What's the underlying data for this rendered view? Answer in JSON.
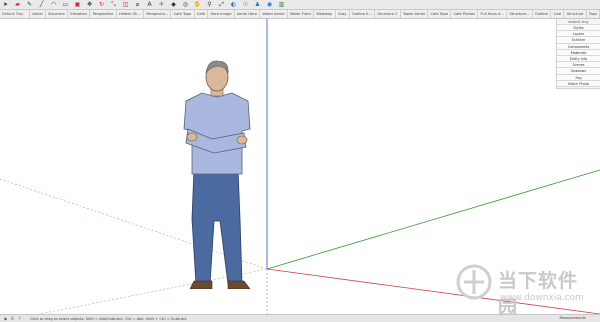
{
  "toolbar": {
    "icons": [
      "select-arrow-icon",
      "eraser-icon",
      "pencil-icon",
      "line-icon",
      "arc-icon",
      "shape-icon",
      "push-pull-icon",
      "move-icon",
      "rotate-icon",
      "scale-icon",
      "offset-icon",
      "tape-measure-icon",
      "text-icon",
      "axes-icon",
      "paint-bucket-icon",
      "orbit-icon",
      "pan-icon",
      "zoom-icon",
      "zoom-extents-icon",
      "previous-view-icon",
      "position-camera-icon",
      "walk-icon",
      "look-around-icon",
      "section-plane-icon"
    ]
  },
  "tabs": {
    "left_label": "Default Tray",
    "items": [
      "Aerial",
      "Structure",
      "Elevation",
      "Perspective",
      "Hidden Sh...",
      "Perspectiv...",
      "Cafe Topo",
      "Café",
      "Hero Image",
      "Aerial Hero",
      "Water Aerial",
      "Water Front",
      "Walkway",
      "Gray",
      "Outline E...",
      "Structure 2",
      "Tower Aerial",
      "Cafe Topo",
      "Cafe Photos",
      "Full Hous A...",
      "Structure...",
      "Outline",
      "Line",
      "Structure",
      "Tops"
    ]
  },
  "tray": {
    "title": "default tray",
    "items": [
      "Styles",
      "Layers",
      "Outliner",
      "Components",
      "Materials",
      "Entity Info",
      "Scenes",
      "Shadows",
      "Fog",
      "Match Photo"
    ]
  },
  "status": {
    "hint": "Click or drag to select objects. Shift = Add/Subtract. Ctrl = Add. Shift + Ctrl = Subtract.",
    "measurements_label": "Measurements"
  },
  "watermark": {
    "text": "当下软件园",
    "url": "www.downxia.com"
  },
  "colors": {
    "red_axis": "#d04040",
    "green_axis": "#2e9a2e",
    "blue_axis": "#3050c8",
    "shirt": "#aab8e0",
    "jeans": "#4a6aa0",
    "skin": "#d9b89c",
    "hair": "#8a8a8a"
  }
}
